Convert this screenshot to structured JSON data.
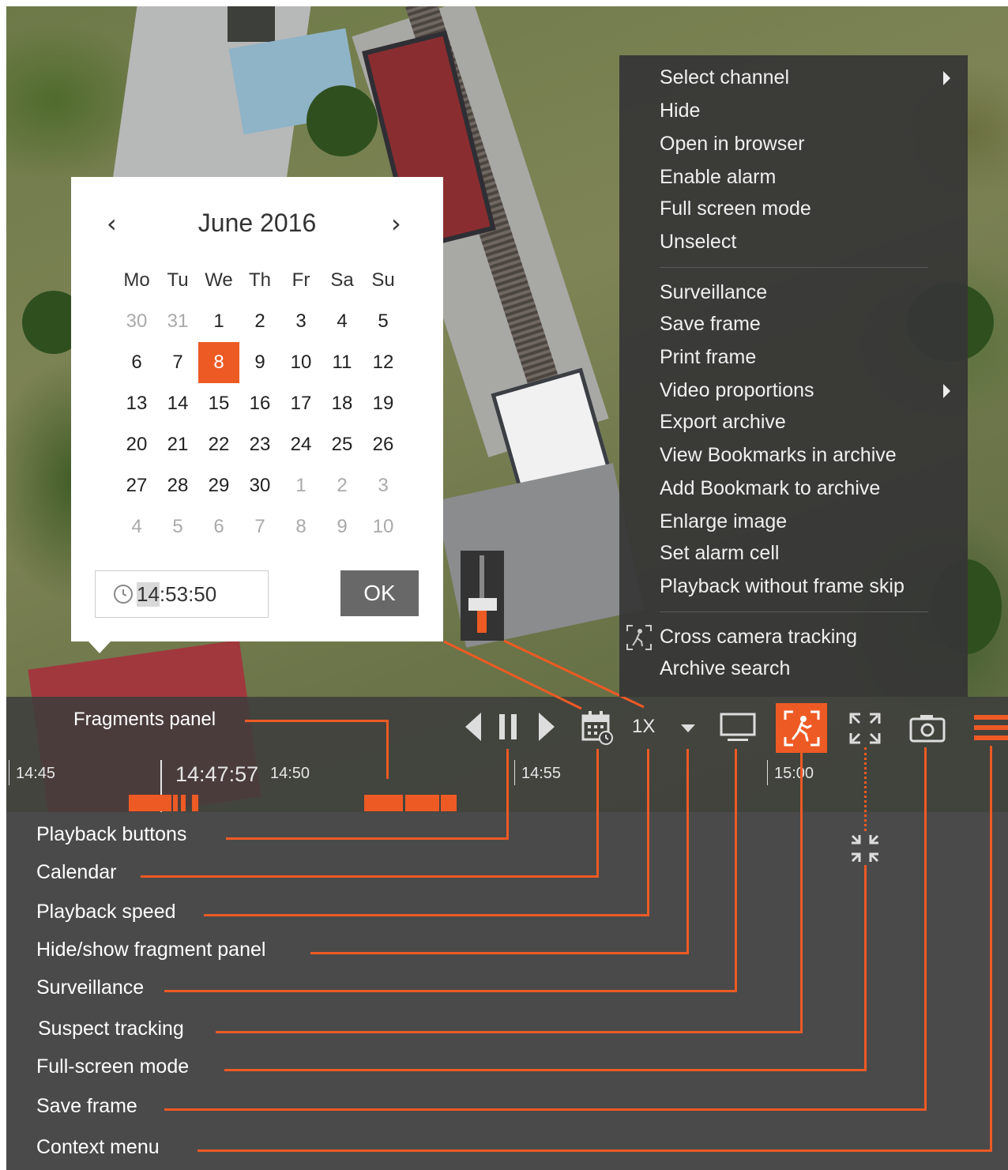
{
  "calendar": {
    "month_title": "June 2016",
    "prev": "‹",
    "next": "›",
    "weekdays": [
      "Mo",
      "Tu",
      "We",
      "Th",
      "Fr",
      "Sa",
      "Su"
    ],
    "days": [
      [
        "30",
        "31",
        "1",
        "2",
        "3",
        "4",
        "5"
      ],
      [
        "6",
        "7",
        "8",
        "9",
        "10",
        "11",
        "12"
      ],
      [
        "13",
        "14",
        "15",
        "16",
        "17",
        "18",
        "19"
      ],
      [
        "20",
        "21",
        "22",
        "23",
        "24",
        "25",
        "26"
      ],
      [
        "27",
        "28",
        "29",
        "30",
        "1",
        "2",
        "3"
      ],
      [
        "4",
        "5",
        "6",
        "7",
        "8",
        "9",
        "10"
      ]
    ],
    "selected_day": "8",
    "time_hours": "14",
    "time_rest": ":53:50",
    "ok_label": "OK"
  },
  "context_menu": {
    "items": [
      "Select channel",
      "Hide",
      "Open in browser",
      "Enable alarm",
      "Full screen mode",
      "Unselect",
      "Surveillance",
      "Save frame",
      "Print frame",
      "Video proportions",
      "Export archive",
      "View Bookmarks in archive",
      "Add Bookmark to archive",
      "Enlarge image",
      "Set alarm cell",
      "Playback without frame skip",
      "Cross camera tracking",
      "Archive search"
    ]
  },
  "timeline": {
    "ticks": [
      "14:45",
      "14:50",
      "14:55",
      "15:00"
    ],
    "current_time": "14:47:57",
    "speed": "1X"
  },
  "annotations": {
    "fragments_panel": "Fragments panel",
    "labels": [
      "Playback buttons",
      "Calendar",
      "Playback speed",
      "Hide/show fragment panel",
      "Surveillance",
      "Suspect tracking",
      "Full-screen mode",
      "Save frame",
      "Context menu"
    ]
  },
  "colors": {
    "accent": "#ee5a24",
    "panel": "#4a4a4a"
  },
  "icons": [
    "step-back-icon",
    "pause-icon",
    "play-icon",
    "calendar-icon",
    "speed-dropdown-icon",
    "monitor-icon",
    "suspect-tracking-icon",
    "fullscreen-icon",
    "exit-fullscreen-icon",
    "camera-icon",
    "hamburger-menu-icon",
    "clock-icon",
    "chevron-right-icon"
  ]
}
